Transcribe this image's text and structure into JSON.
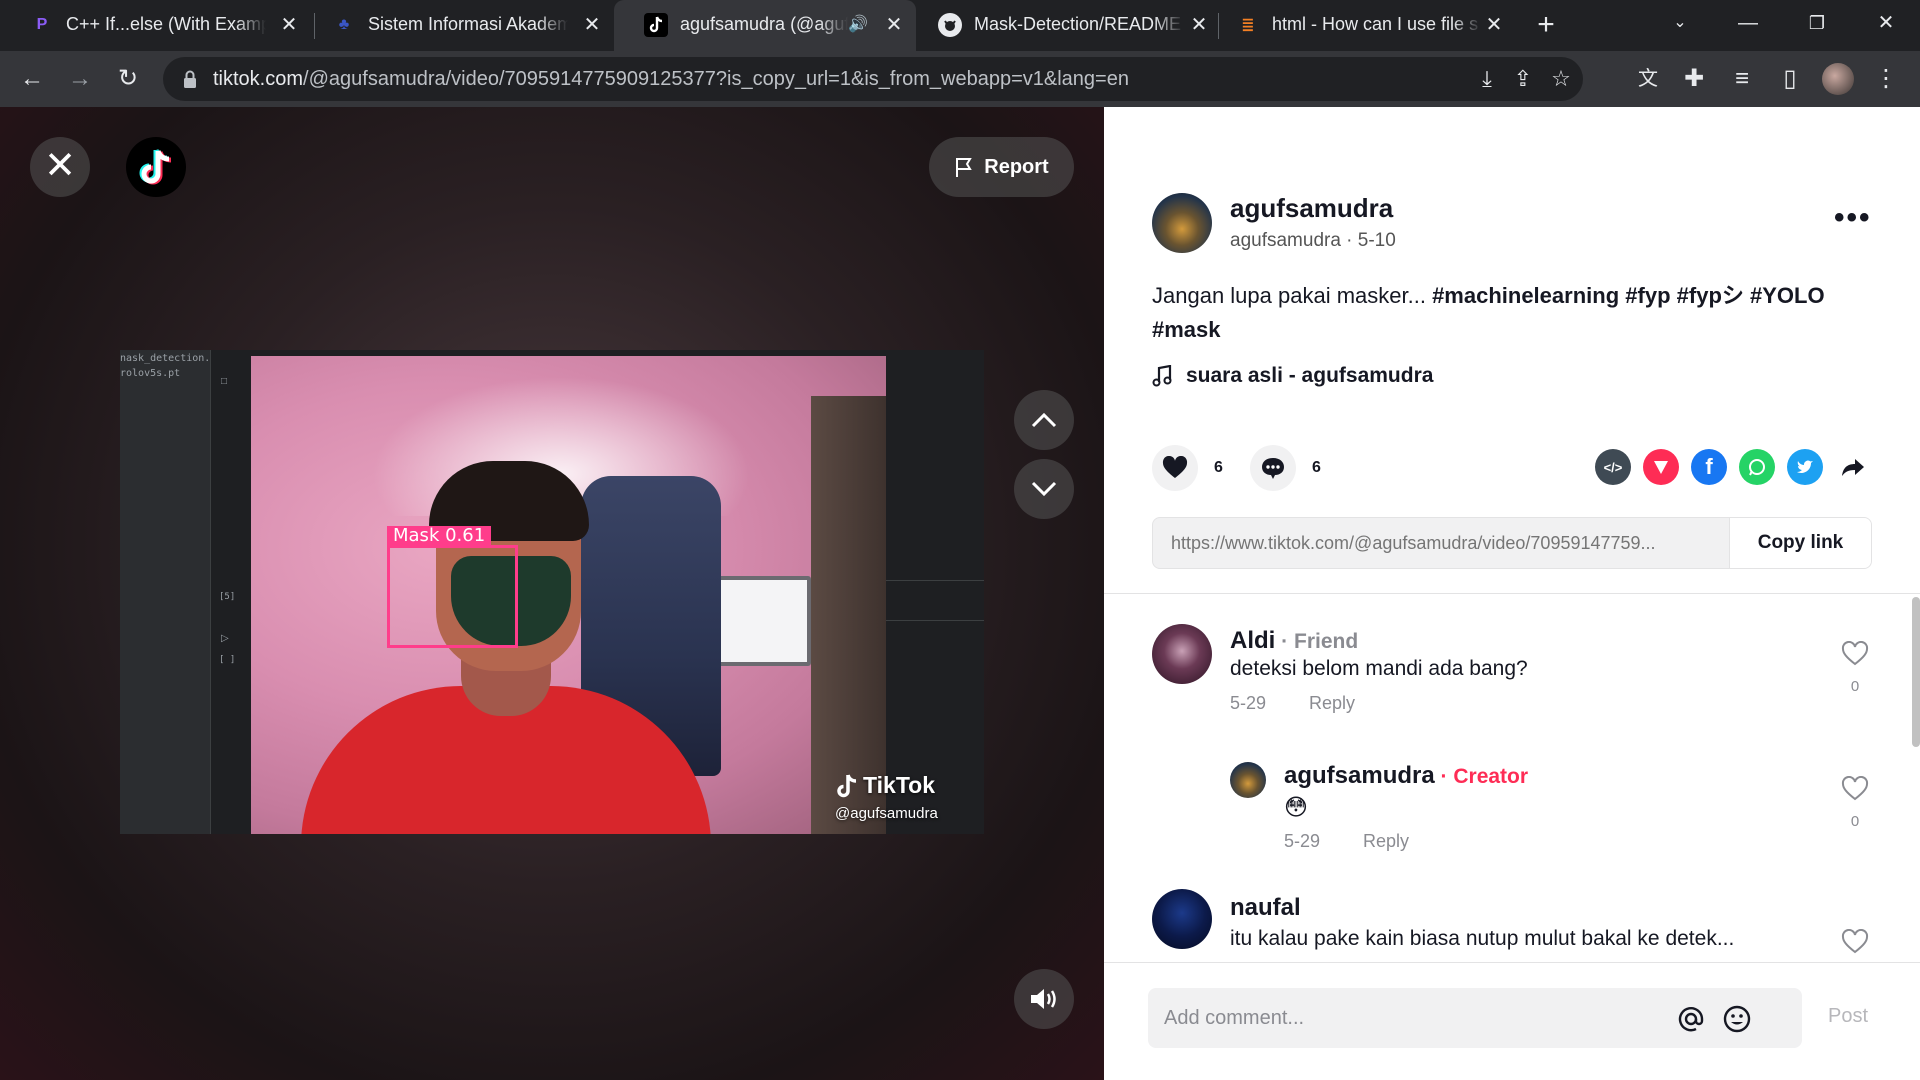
{
  "browser": {
    "tabs": [
      {
        "title": "C++ If...else (With Exampl",
        "favicon": "programiz-icon",
        "active": false
      },
      {
        "title": "Sistem Informasi Akademi",
        "favicon": "university-icon",
        "active": false
      },
      {
        "title": "agufsamudra (@aguf",
        "favicon": "tiktok-icon",
        "active": true,
        "audio": true
      },
      {
        "title": "Mask-Detection/README",
        "favicon": "github-icon",
        "active": false
      },
      {
        "title": "html - How can I use file s",
        "favicon": "stackoverflow-icon",
        "active": false
      }
    ],
    "url_host": "tiktok.com",
    "url_path": "/@agufsamudra/video/7095914775909125377?is_copy_url=1&is_from_webapp=v1&lang=en"
  },
  "video": {
    "report_label": "Report",
    "ide_file_1": "nask_detection.ip...",
    "ide_file_2": "rolov5s.pt",
    "ide_marker_1": "[5]",
    "ide_marker_2": "[ ]",
    "detection_label": "Mask  0.61",
    "watermark_brand": "TikTok",
    "watermark_handle": "@agufsamudra"
  },
  "post": {
    "author_name": "agufsamudra",
    "author_sub": "agufsamudra · 5-10",
    "caption_text": "Jangan lupa pakai masker... ",
    "hashtags": [
      "#machinelearning",
      "#fyp",
      "#fypシ",
      "#YOLO",
      "#mask"
    ],
    "music": "suara asli - agufsamudra",
    "likes": "6",
    "comments_count": "6",
    "share_link": "https://www.tiktok.com/@agufsamudra/video/70959147759...",
    "copy_label": "Copy link"
  },
  "comments": [
    {
      "name": "Aldi",
      "badge": " · Friend",
      "text": "deteksi belom mandi ada bang?",
      "date": "5-29",
      "reply": "Reply",
      "likes": "0"
    },
    {
      "name": "agufsamudra",
      "badge": " · Creator",
      "text": "😳",
      "date": "5-29",
      "reply": "Reply",
      "likes": "0"
    },
    {
      "name": "naufal",
      "text": "itu kalau pake kain biasa nutup mulut bakal ke detek..."
    }
  ],
  "composer": {
    "placeholder": "Add comment...",
    "post_label": "Post"
  },
  "colors": {
    "accent": "#fe2c55",
    "bbox": "#ff3d8b",
    "shirt": "#d8262c"
  }
}
